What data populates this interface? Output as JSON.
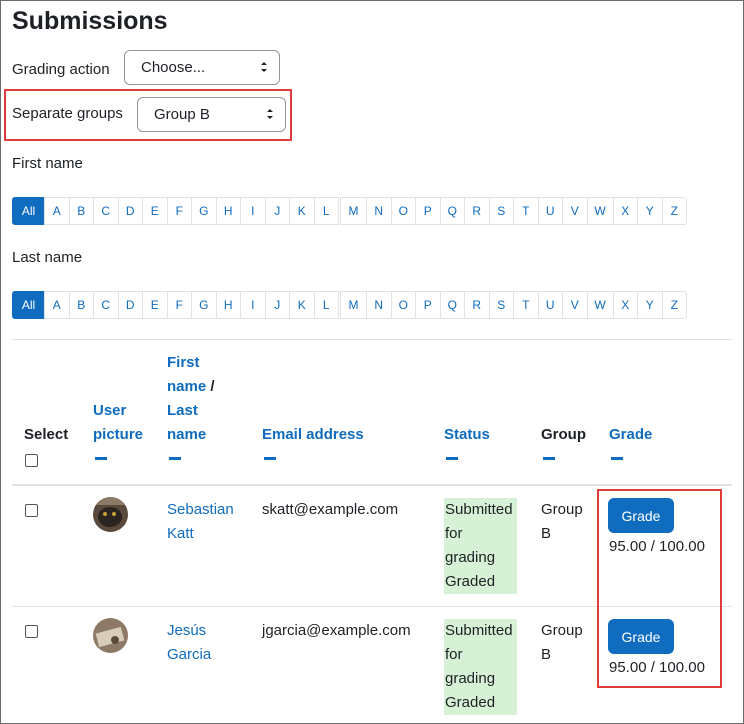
{
  "page": {
    "title": "Submissions"
  },
  "grading_action": {
    "label": "Grading action",
    "selected": "Choose..."
  },
  "separate_groups": {
    "label": "Separate groups",
    "selected": "Group B"
  },
  "first_name": {
    "label": "First name",
    "letters": [
      "All",
      "A",
      "B",
      "C",
      "D",
      "E",
      "F",
      "G",
      "H",
      "I",
      "J",
      "K",
      "L",
      "M",
      "N",
      "O",
      "P",
      "Q",
      "R",
      "S",
      "T",
      "U",
      "V",
      "W",
      "X",
      "Y",
      "Z"
    ],
    "active": "All"
  },
  "last_name": {
    "label": "Last name",
    "letters": [
      "All",
      "A",
      "B",
      "C",
      "D",
      "E",
      "F",
      "G",
      "H",
      "I",
      "J",
      "K",
      "L",
      "M",
      "N",
      "O",
      "P",
      "Q",
      "R",
      "S",
      "T",
      "U",
      "V",
      "W",
      "X",
      "Y",
      "Z"
    ],
    "active": "All"
  },
  "table": {
    "headers": {
      "select": "Select",
      "user_picture_1": "User",
      "user_picture_2": "picture",
      "first_name_1": "First",
      "first_name_2": "name",
      "slash": "/",
      "last_name_1": "Last",
      "last_name_2": "name",
      "email": "Email address",
      "status": "Status",
      "group": "Group",
      "grade": "Grade"
    },
    "rows": [
      {
        "first": "Sebastian",
        "last": "Katt",
        "email": "skatt@example.com",
        "status": [
          "Submitted",
          "for",
          "grading",
          "Graded"
        ],
        "group": [
          "Group",
          "B"
        ],
        "grade_button": "Grade",
        "grade_value": "95.00 / 100.00"
      },
      {
        "first": "Jesús",
        "last": "Garcia",
        "email": "jgarcia@example.com",
        "status": [
          "Submitted",
          "for",
          "grading",
          "Graded"
        ],
        "group": [
          "Group",
          "B"
        ],
        "grade_button": "Grade",
        "grade_value": "95.00 / 100.00"
      }
    ]
  },
  "colors": {
    "link": "#0f6cbf",
    "highlight_border": "#e03b3b",
    "status_bg": "#d7f1d6"
  }
}
